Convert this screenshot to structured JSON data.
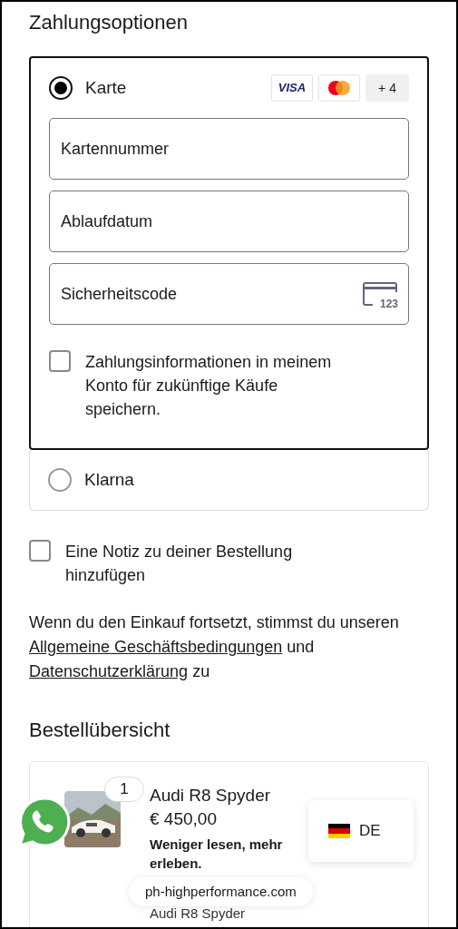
{
  "heading": "Zahlungsoptionen",
  "payment_options": [
    {
      "label": "Karte",
      "selected": true,
      "brands": [
        {
          "kind": "visa",
          "text": "VISA"
        },
        {
          "kind": "mastercard"
        },
        {
          "kind": "more",
          "text": "+ 4"
        }
      ],
      "fields": [
        {
          "placeholder": "Kartennummer"
        },
        {
          "placeholder": "Ablaufdatum"
        },
        {
          "placeholder": "Sicherheitscode",
          "icon_label": "123"
        }
      ],
      "save_option": {
        "label": "Zahlungsinformationen in meinem Konto für zukünftige Käufe speichern.",
        "checked": false
      }
    },
    {
      "label": "Klarna",
      "selected": false
    }
  ],
  "note_option": {
    "label": "Eine Notiz zu deiner Bestellung hinzufügen",
    "checked": false
  },
  "consent": [
    {
      "kind": "text",
      "text": "Wenn du den Einkauf fortsetzt, stimmst du unseren"
    },
    {
      "kind": "link",
      "text": "Allgemeine Geschäftsbedingungen"
    },
    {
      "kind": "text",
      "text": "und"
    },
    {
      "kind": "link",
      "text": "Datenschutzerklärung"
    },
    {
      "kind": "text",
      "text": "zu"
    }
  ],
  "order_summary": {
    "title": "Bestellübersicht",
    "items": [
      {
        "quantity": "1",
        "name": "Audi R8 Spyder",
        "price": "€ 450,00",
        "description": "Weniger lesen, mehr erleben.",
        "variant": "Audi R8 Spyder"
      }
    ]
  },
  "language_popup": {
    "code": "DE"
  },
  "url_bar": {
    "url": "ph-highperformance.com"
  }
}
